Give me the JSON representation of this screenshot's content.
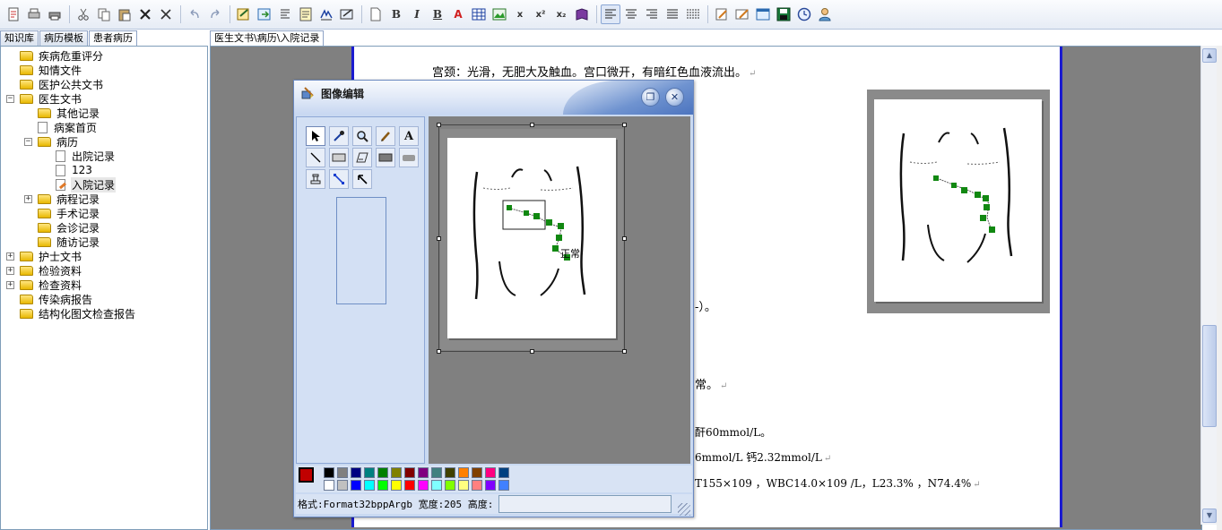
{
  "toolbar": {
    "buttons": [
      "new-icon",
      "print-icon",
      "print-preview-icon",
      "cut-icon",
      "copy-icon",
      "paste-icon",
      "delete-icon",
      "clear-icon",
      "undo-icon",
      "redo-icon",
      "edit-form-icon",
      "export-icon",
      "format-paragraph-icon",
      "note-icon",
      "signature-icon",
      "screenshot-icon",
      "blank-page-icon",
      "bold-icon",
      "italic-icon",
      "underline-icon",
      "font-color-icon",
      "table-icon",
      "image-icon",
      "fraction-icon",
      "superscript-icon",
      "subscript-icon",
      "book-icon",
      "align-left-icon",
      "align-center-icon",
      "align-right-icon",
      "justify-icon",
      "line-spacing-icon",
      "edit-note-icon",
      "edit-record-icon",
      "window-icon",
      "save-icon",
      "clock-icon",
      "user-icon"
    ],
    "bold_glyph": "B",
    "italic_glyph": "I",
    "underline_glyph": "B",
    "font_color_glyph": "A",
    "fraction_glyph": "x",
    "superscript_glyph": "x²",
    "subscript_glyph": "x₂"
  },
  "left_tabs": [
    "知识库",
    "病历模板",
    "患者病历"
  ],
  "left_tab_active": 2,
  "doc_tab": "医生文书\\病历\\入院记录",
  "tree": [
    {
      "label": "疾病危重评分",
      "icon": "folder",
      "toggle": "",
      "level": 0
    },
    {
      "label": "知情文件",
      "icon": "folder",
      "toggle": "",
      "level": 0
    },
    {
      "label": "医护公共文书",
      "icon": "folder",
      "toggle": "",
      "level": 0
    },
    {
      "label": "医生文书",
      "icon": "folder",
      "toggle": "-",
      "level": 0
    },
    {
      "label": "其他记录",
      "icon": "folder",
      "toggle": "",
      "level": 1
    },
    {
      "label": "病案首页",
      "icon": "doc",
      "toggle": "",
      "level": 1
    },
    {
      "label": "病历",
      "icon": "folder",
      "toggle": "-",
      "level": 1
    },
    {
      "label": "出院记录",
      "icon": "doc",
      "toggle": "",
      "level": 2
    },
    {
      "label": "123",
      "icon": "doc",
      "toggle": "",
      "level": 2
    },
    {
      "label": "入院记录",
      "icon": "doc-edit",
      "toggle": "",
      "level": 2,
      "selected": true
    },
    {
      "label": "病程记录",
      "icon": "folder",
      "toggle": "+",
      "level": 1
    },
    {
      "label": "手术记录",
      "icon": "folder",
      "toggle": "",
      "level": 1
    },
    {
      "label": "会诊记录",
      "icon": "folder",
      "toggle": "",
      "level": 1
    },
    {
      "label": "随访记录",
      "icon": "folder",
      "toggle": "",
      "level": 1
    },
    {
      "label": "护士文书",
      "icon": "folder",
      "toggle": "+",
      "level": 0
    },
    {
      "label": "检验资料",
      "icon": "folder",
      "toggle": "+",
      "level": 0
    },
    {
      "label": "检查资料",
      "icon": "folder",
      "toggle": "+",
      "level": 0
    },
    {
      "label": "传染病报告",
      "icon": "folder",
      "toggle": "",
      "level": 0
    },
    {
      "label": "结构化图文检查报告",
      "icon": "folder",
      "toggle": "",
      "level": 0
    }
  ],
  "document": {
    "lines": [
      "宫颈：光滑，无肥大及触血。宫口微开，有暗红色血液流出。",
      "-）。",
      "常。",
      "酐60mmol/L。",
      "6mmol/L 钙2.32mmol/L",
      "T155×109 ，WBC14.0×109 /L，L23.3% ，N74.4%"
    ],
    "paragraph_mark": "↵"
  },
  "dialog": {
    "title": "图像编辑",
    "restore_glyph": "❐",
    "close_glyph": "✕",
    "tools": [
      "select-arrow-icon",
      "eyedropper-icon",
      "zoom-icon",
      "pencil-icon",
      "text-icon",
      "line-icon",
      "rectangle-icon",
      "parallelogram-icon",
      "filled-rectangle-icon",
      "rounded-rect-icon",
      "stamp-icon",
      "connector-icon",
      "pointer-icon"
    ],
    "text_tool_glyph": "A",
    "canvas_annotation": "正常",
    "status_text": "格式:Format32bppArgb 宽度:205 高度:",
    "status_value": "",
    "palette_row1": [
      "#000000",
      "#808080",
      "#000080",
      "#008080",
      "#008000",
      "#808000",
      "#800000",
      "#800080",
      "#408080",
      "#404000",
      "#ff8000",
      "#804000",
      "#ff0080",
      "#004080"
    ],
    "palette_row2": [
      "#ffffff",
      "#c0c0c0",
      "#0000ff",
      "#00ffff",
      "#00ff00",
      "#ffff00",
      "#ff0000",
      "#ff00ff",
      "#80ffff",
      "#80ff00",
      "#ffff80",
      "#ff8080",
      "#8000ff",
      "#4080ff"
    ],
    "current_color": "#c00000"
  },
  "colors": {
    "page_border": "#1b1bd0",
    "marker_green": "#118811",
    "dialog_bg": "#c9d9f1"
  }
}
